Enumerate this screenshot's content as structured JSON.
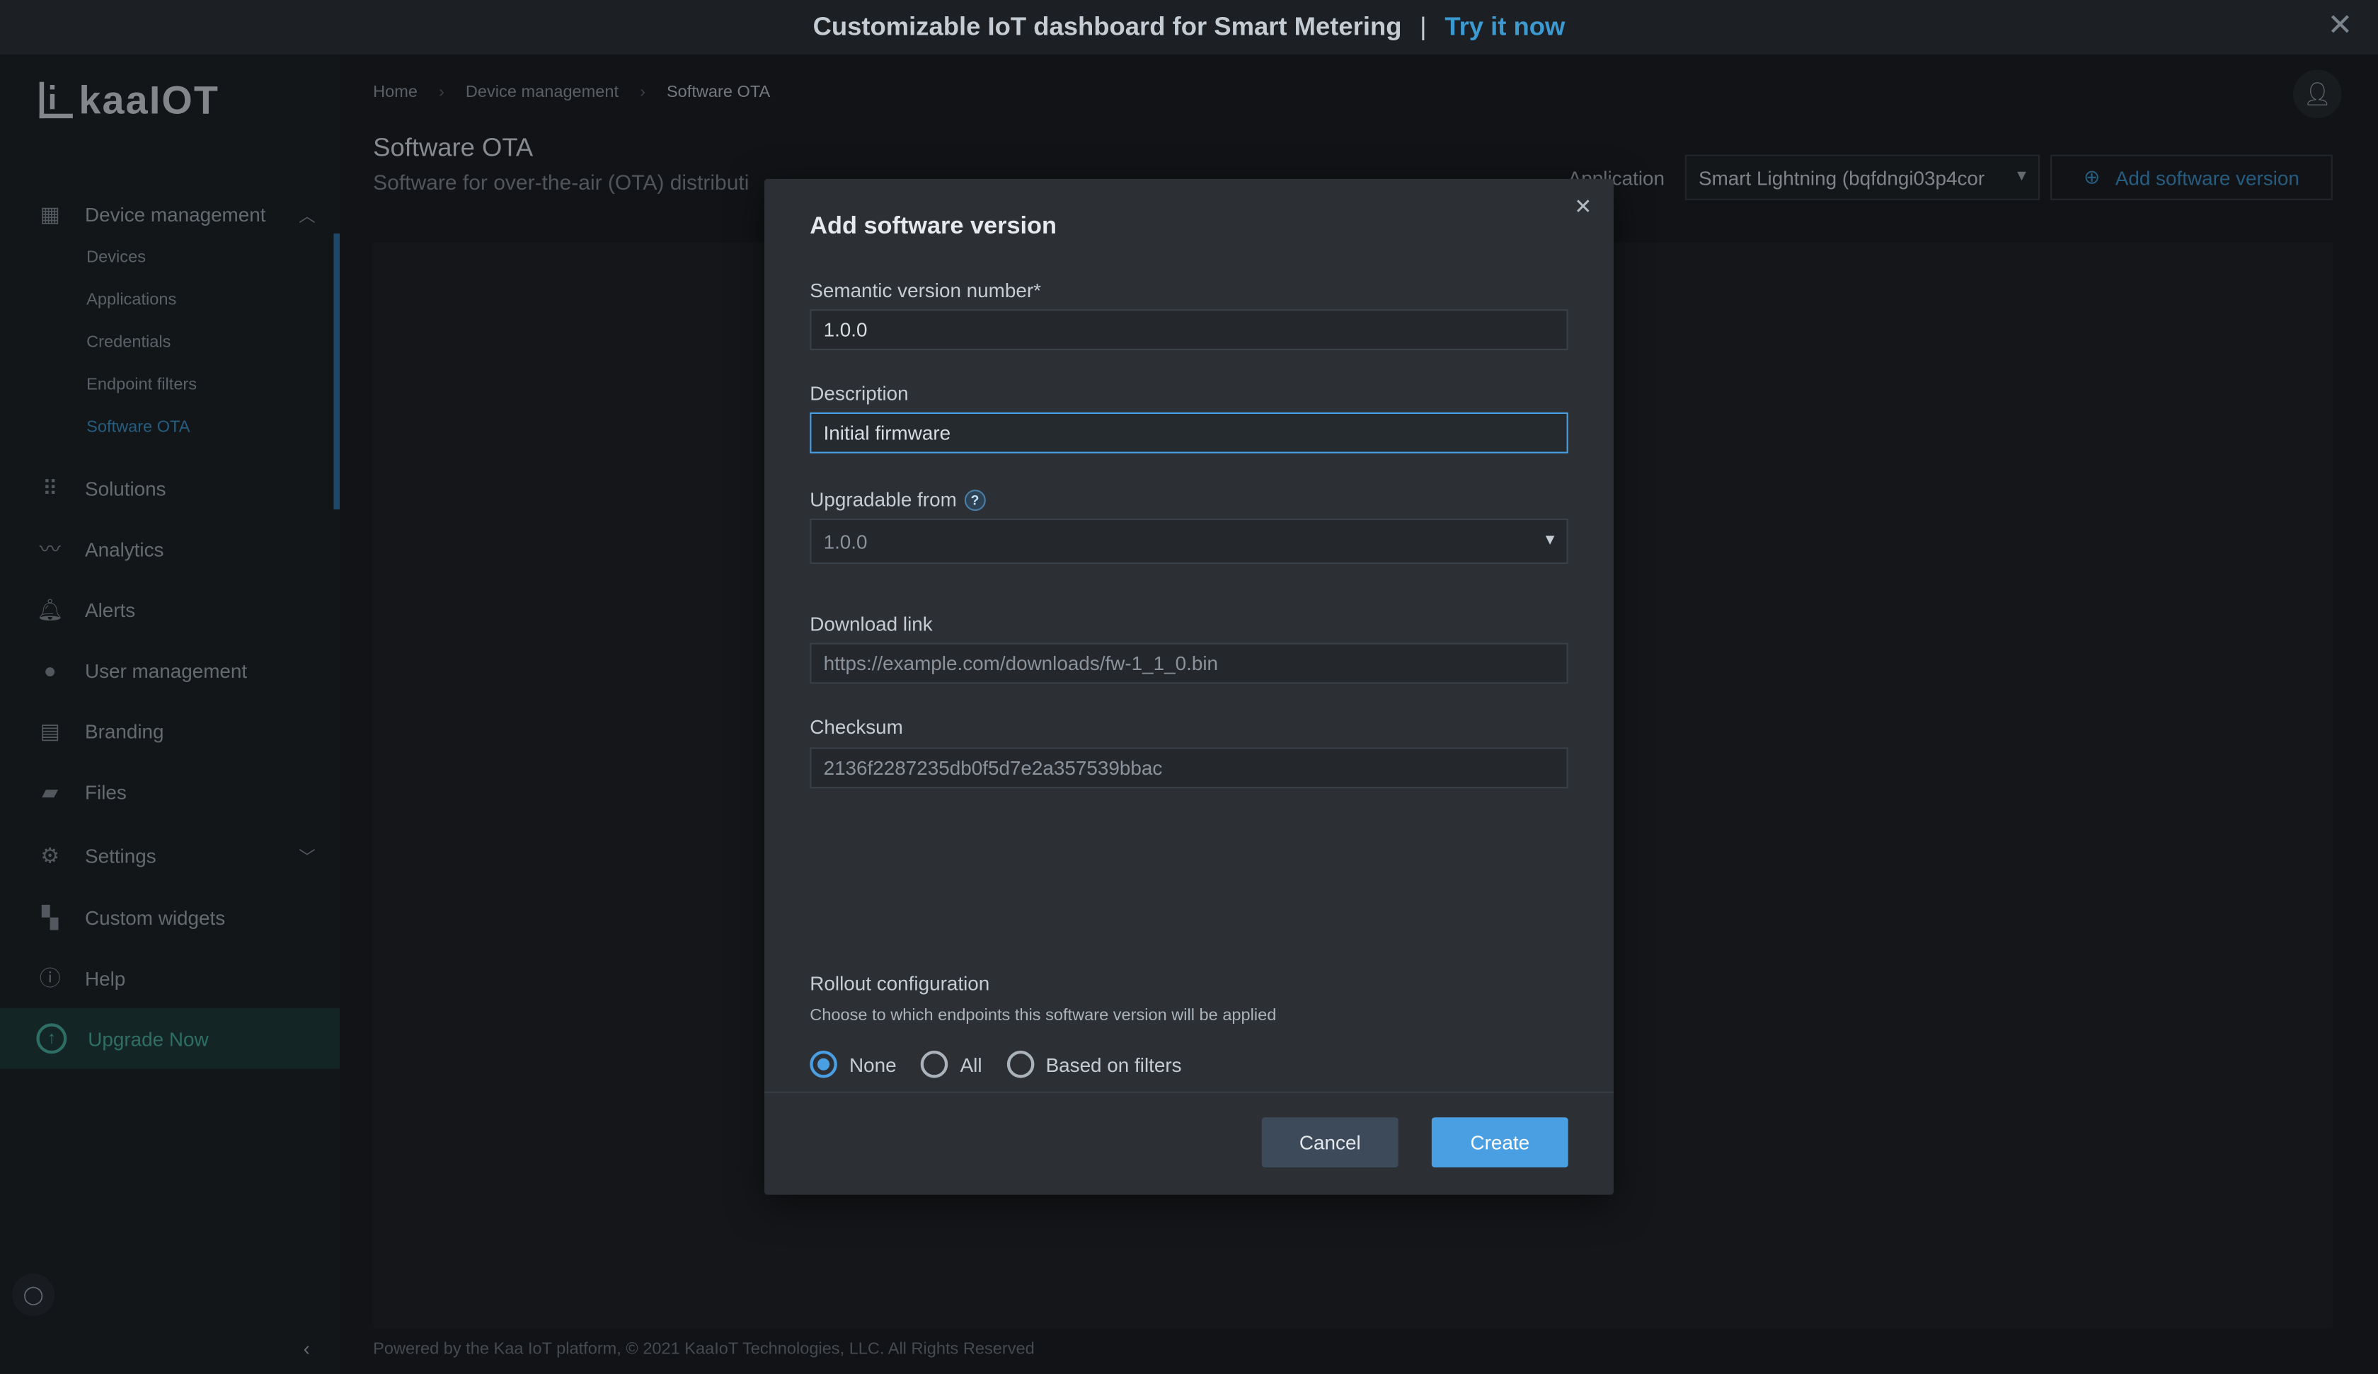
{
  "banner": {
    "text": "Customizable IoT dashboard for Smart Metering",
    "separator": "|",
    "link": "Try it now",
    "close_icon": "close-icon"
  },
  "sidebar": {
    "logo": "kaaIOT",
    "device_management": {
      "label": "Device management",
      "sub_items": [
        "Devices",
        "Applications",
        "Credentials",
        "Endpoint filters",
        "Software OTA"
      ],
      "active_sub": "Software OTA"
    },
    "items": [
      {
        "label": "Solutions",
        "icon": "grid-icon"
      },
      {
        "label": "Analytics",
        "icon": "analytics-icon"
      },
      {
        "label": "Alerts",
        "icon": "bell-icon"
      },
      {
        "label": "User management",
        "icon": "user-circle-icon"
      },
      {
        "label": "Branding",
        "icon": "branding-icon"
      },
      {
        "label": "Files",
        "icon": "folder-icon"
      },
      {
        "label": "Settings",
        "icon": "gear-icon"
      },
      {
        "label": "Custom widgets",
        "icon": "widgets-icon"
      },
      {
        "label": "Help",
        "icon": "help-icon"
      }
    ],
    "upgrade": "Upgrade Now"
  },
  "breadcrumb": [
    "Home",
    "Device management",
    "Software OTA"
  ],
  "page": {
    "title": "Software OTA",
    "subtitle": "Software for over-the-air (OTA) distributi",
    "application_label": "Application",
    "application_value": "Smart Lightning (bqfdngi03p4cor",
    "add_button": "Add software version"
  },
  "footer": "Powered by the Kaa IoT platform, © 2021 KaaIoT Technologies, LLC. All Rights Reserved",
  "modal": {
    "title": "Add software version",
    "semantic_label": "Semantic version number*",
    "semantic_value": "1.0.0",
    "description_label": "Description",
    "description_value": "Initial firmware",
    "upgradable_label": "Upgradable from",
    "upgradable_value": "1.0.0",
    "download_label": "Download link",
    "download_placeholder": "https://example.com/downloads/fw-1_1_0.bin",
    "checksum_label": "Checksum",
    "checksum_placeholder": "2136f2287235db0f5d7e2a357539bbac",
    "rollout_title": "Rollout configuration",
    "rollout_sub": "Choose to which endpoints this software version will be applied",
    "rollout_options": [
      "None",
      "All",
      "Based on filters"
    ],
    "rollout_selected": "None",
    "cancel": "Cancel",
    "create": "Create"
  },
  "colors": {
    "accent": "#4a9ee2",
    "link": "#3d9ad1",
    "upgrade": "#49a99b"
  }
}
